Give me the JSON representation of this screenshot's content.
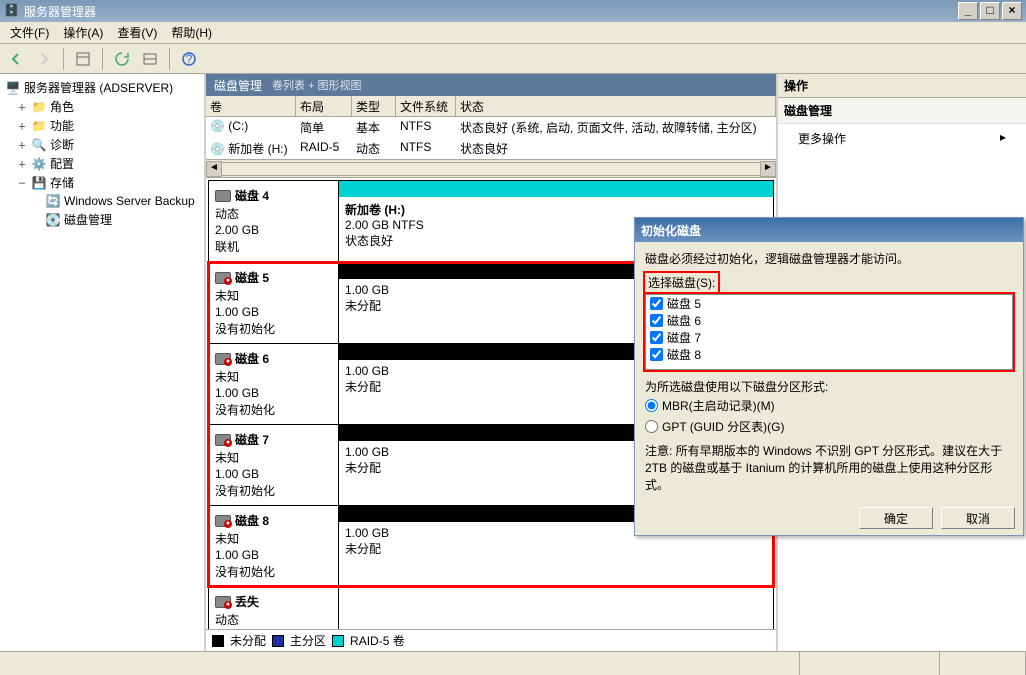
{
  "window": {
    "title": "服务器管理器"
  },
  "menu": {
    "file": "文件(F)",
    "action": "操作(A)",
    "view": "查看(V)",
    "help": "帮助(H)"
  },
  "tree": {
    "root": "服务器管理器 (ADSERVER)",
    "roles": "角色",
    "features": "功能",
    "diag": "诊断",
    "config": "配置",
    "storage": "存储",
    "wsb": "Windows Server Backup",
    "diskmgmt": "磁盘管理"
  },
  "midheader": {
    "title": "磁盘管理",
    "sub": "卷列表 + 图形视图"
  },
  "vol_cols": {
    "vol": "卷",
    "layout": "布局",
    "type": "类型",
    "fs": "文件系统",
    "status": "状态"
  },
  "volumes": [
    {
      "vol": "(C:)",
      "layout": "简单",
      "type": "基本",
      "fs": "NTFS",
      "status": "状态良好 (系统, 启动, 页面文件, 活动, 故障转储, 主分区)"
    },
    {
      "vol": "新加卷 (H:)",
      "layout": "RAID-5",
      "type": "动态",
      "fs": "NTFS",
      "status": "状态良好"
    }
  ],
  "disk4": {
    "name": "磁盘 4",
    "kind": "动态",
    "size": "2.00 GB",
    "state": "联机",
    "part_title": "新加卷    (H:)",
    "part_size": "2.00 GB NTFS",
    "part_state": "状态良好",
    "barcolor": "#00d2d2"
  },
  "udisks": [
    {
      "name": "磁盘 5",
      "kind": "未知",
      "size": "1.00 GB",
      "state": "没有初始化",
      "psize": "1.00 GB",
      "pstate": "未分配"
    },
    {
      "name": "磁盘 6",
      "kind": "未知",
      "size": "1.00 GB",
      "state": "没有初始化",
      "psize": "1.00 GB",
      "pstate": "未分配"
    },
    {
      "name": "磁盘 7",
      "kind": "未知",
      "size": "1.00 GB",
      "state": "没有初始化",
      "psize": "1.00 GB",
      "pstate": "未分配"
    },
    {
      "name": "磁盘 8",
      "kind": "未知",
      "size": "1.00 GB",
      "state": "没有初始化",
      "psize": "1.00 GB",
      "pstate": "未分配"
    }
  ],
  "lost": {
    "name": "丢失",
    "kind": "动态"
  },
  "legend": {
    "unalloc": "未分配",
    "primary": "主分区",
    "raid5": "RAID-5 卷"
  },
  "actions": {
    "hdr": "操作",
    "section": "磁盘管理",
    "more": "更多操作",
    "arrow": "▸"
  },
  "dialog": {
    "title": "初始化磁盘",
    "msg": "磁盘必须经过初始化，逻辑磁盘管理器才能访问。",
    "select_label": "选择磁盘(S):",
    "items": [
      "磁盘 5",
      "磁盘 6",
      "磁盘 7",
      "磁盘 8"
    ],
    "style_label": "为所选磁盘使用以下磁盘分区形式:",
    "mbr": "MBR(主启动记录)(M)",
    "gpt": "GPT (GUID 分区表)(G)",
    "note": "注意: 所有早期版本的 Windows 不识别 GPT 分区形式。建议在大于 2TB 的磁盘或基于 Itanium 的计算机所用的磁盘上使用这种分区形式。",
    "ok": "确定",
    "cancel": "取消"
  }
}
